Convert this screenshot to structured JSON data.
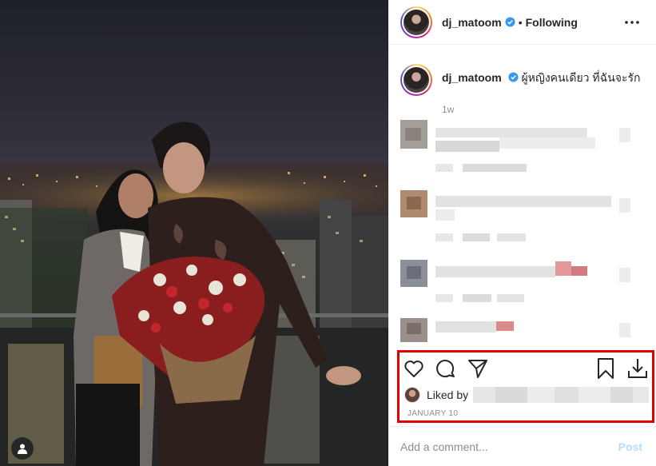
{
  "post": {
    "username": "dj_matoom",
    "follow_status": "Following",
    "separator": "•",
    "caption": "ผู้หญิงคนเดียว ที่ฉันจะรัก",
    "time_ago": "1w",
    "liked_by_label": "Liked by",
    "date": "JANUARY 10"
  },
  "comment_box": {
    "placeholder": "Add a comment...",
    "post_label": "Post"
  },
  "icons": {
    "verified": "verified-badge-icon",
    "more": "more-options-icon",
    "like": "heart-icon",
    "comment": "comment-bubble-icon",
    "share": "paper-plane-icon",
    "save": "bookmark-icon",
    "download": "download-icon",
    "tagged_user": "user-icon"
  },
  "colors": {
    "verified_blue": "#3897f0",
    "highlight_border": "#e00000",
    "post_button": "#b2dffc",
    "muted_text": "#8e8e8e"
  }
}
